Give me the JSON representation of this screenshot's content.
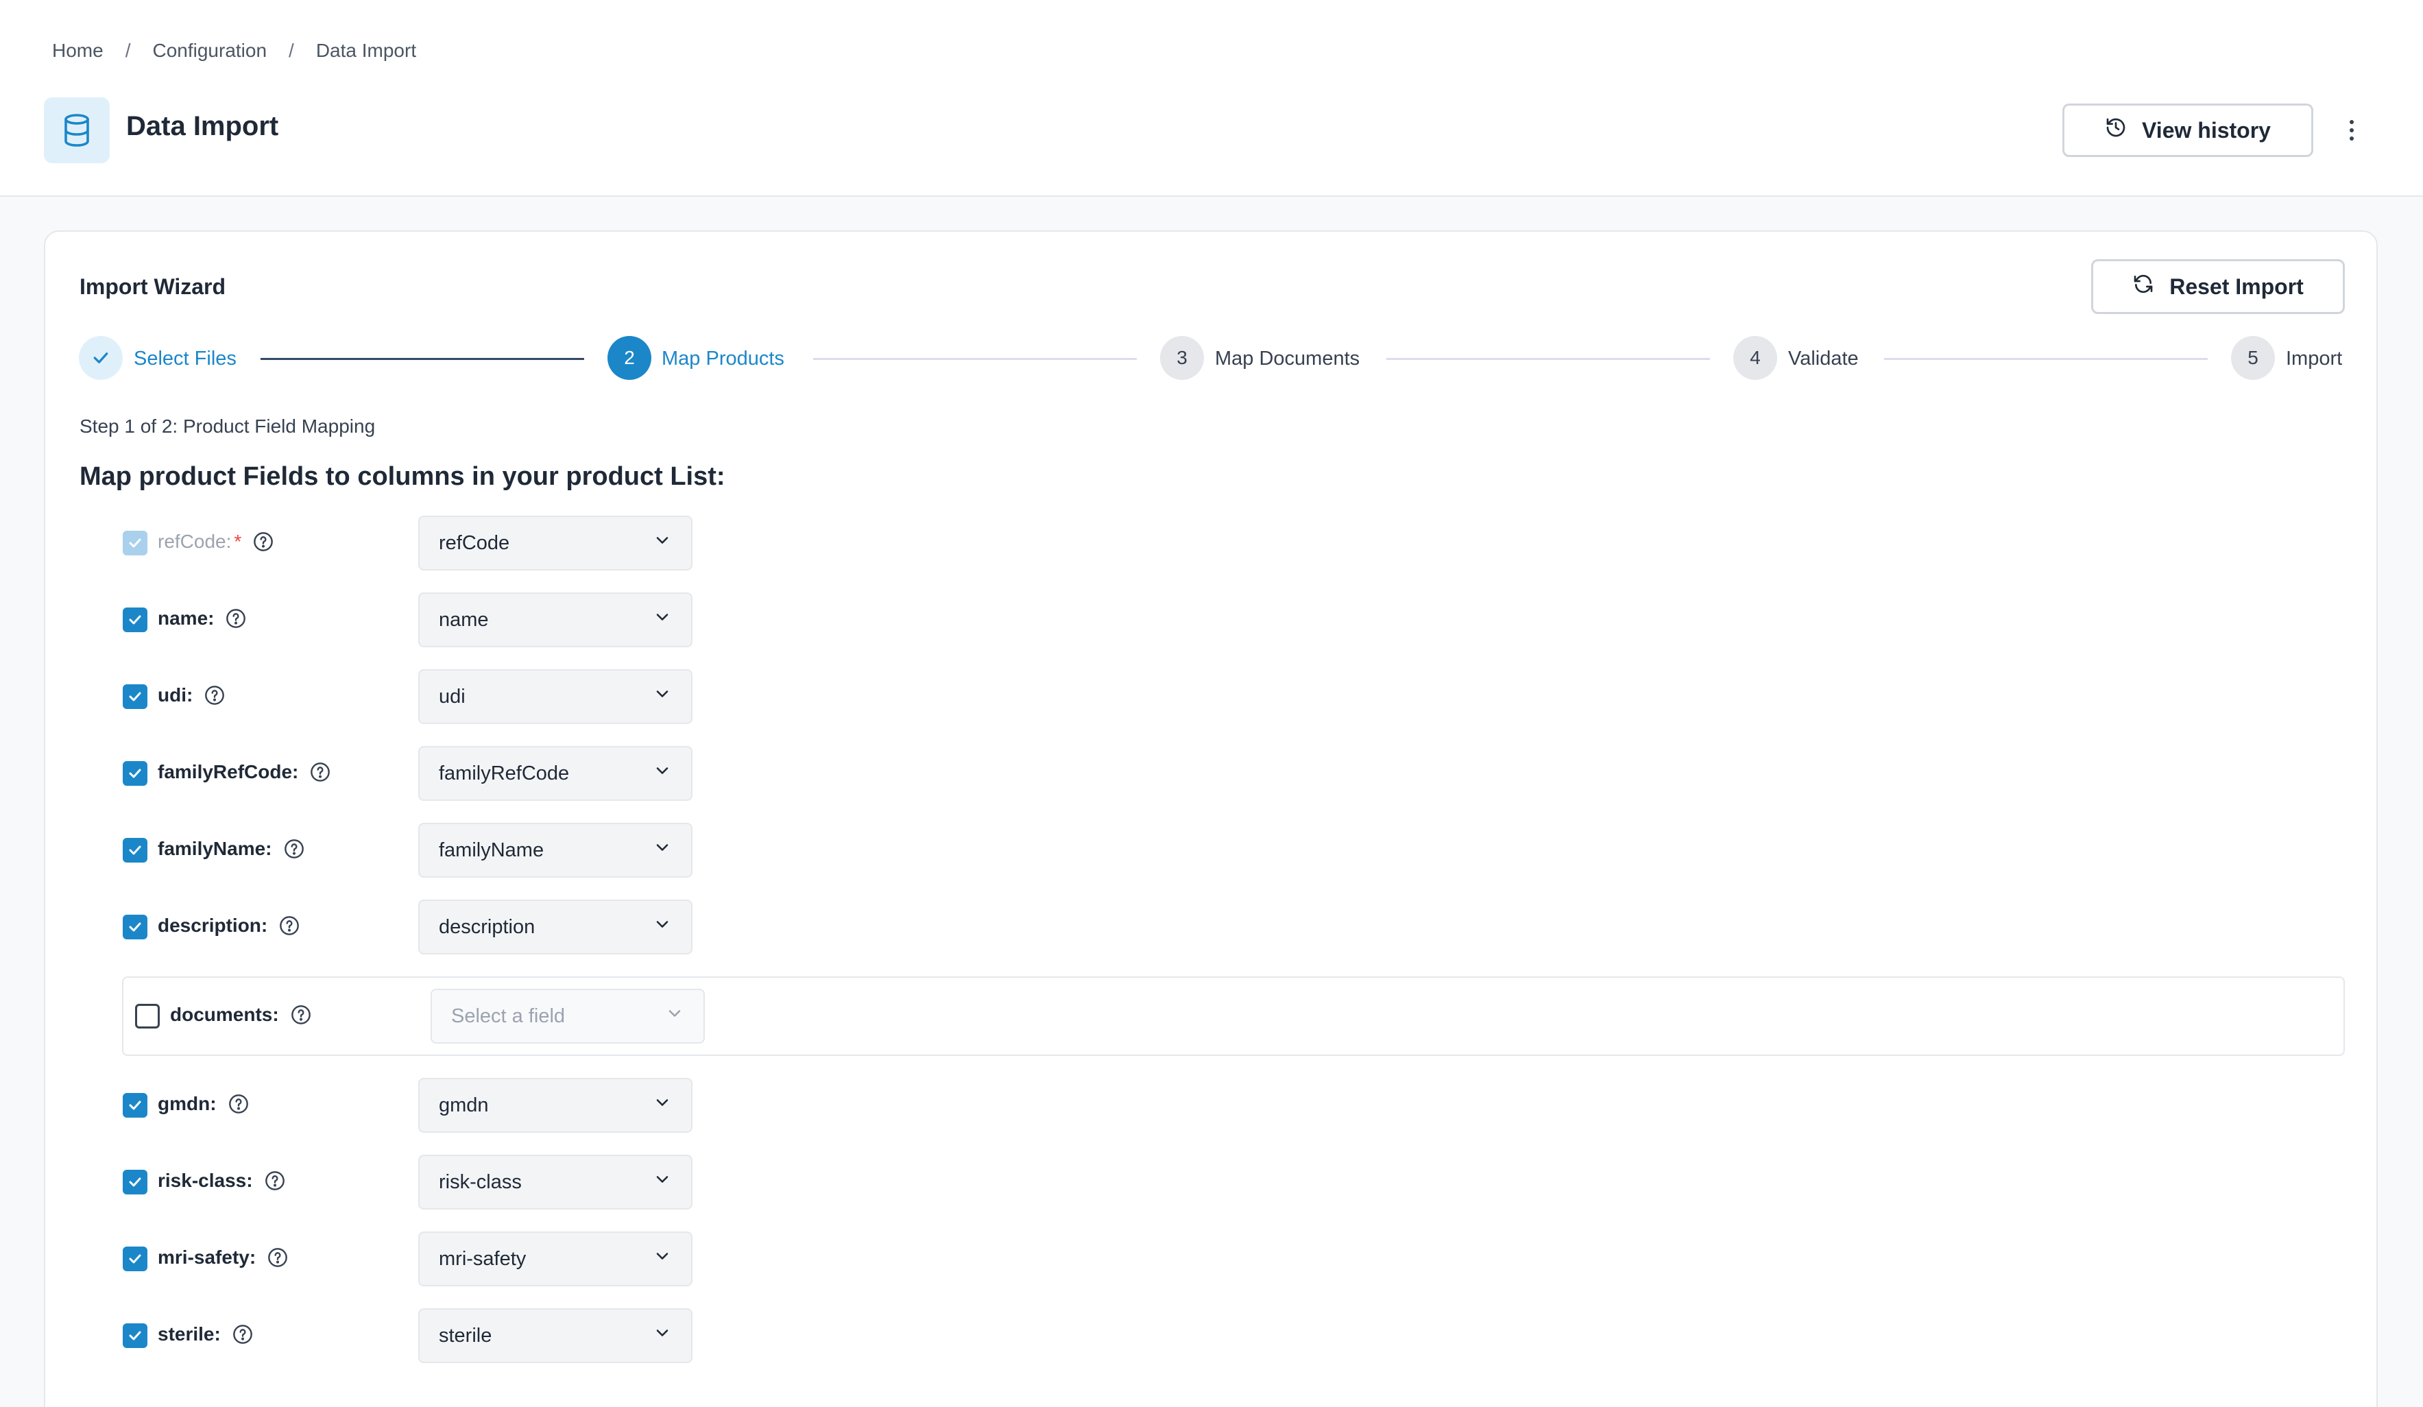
{
  "breadcrumb": [
    "Home",
    "Configuration",
    "Data Import"
  ],
  "header": {
    "title": "Data Import",
    "icon": "database-icon",
    "view_history_label": "View history"
  },
  "wizard": {
    "title": "Import Wizard",
    "reset_label": "Reset Import",
    "steps": [
      {
        "number": "1",
        "label": "Select Files",
        "state": "done"
      },
      {
        "number": "2",
        "label": "Map Products",
        "state": "active"
      },
      {
        "number": "3",
        "label": "Map Documents",
        "state": "todo"
      },
      {
        "number": "4",
        "label": "Validate",
        "state": "todo"
      },
      {
        "number": "5",
        "label": "Import",
        "state": "todo"
      }
    ],
    "step_caption": "Step 1 of 2: Product Field Mapping",
    "heading": "Map product Fields to columns in your product List:"
  },
  "fields": [
    {
      "label": "refCode:",
      "required": true,
      "checked": true,
      "disabled": true,
      "value": "refCode"
    },
    {
      "label": "name:",
      "checked": true,
      "value": "name"
    },
    {
      "label": "udi:",
      "checked": true,
      "value": "udi"
    },
    {
      "label": "familyRefCode:",
      "checked": true,
      "value": "familyRefCode"
    },
    {
      "label": "familyName:",
      "checked": true,
      "value": "familyName"
    },
    {
      "label": "description:",
      "checked": true,
      "value": "description"
    },
    {
      "label": "documents:",
      "checked": false,
      "value": "",
      "placeholder": "Select a field"
    },
    {
      "label": "gmdn:",
      "checked": true,
      "value": "gmdn"
    },
    {
      "label": "risk-class:",
      "checked": true,
      "value": "risk-class"
    },
    {
      "label": "mri-safety:",
      "checked": true,
      "value": "mri-safety"
    },
    {
      "label": "sterile:",
      "checked": true,
      "value": "sterile"
    }
  ],
  "colors": {
    "accent": "#1b87c9",
    "accent_light": "#e0f0fb",
    "required": "#ef4444"
  }
}
